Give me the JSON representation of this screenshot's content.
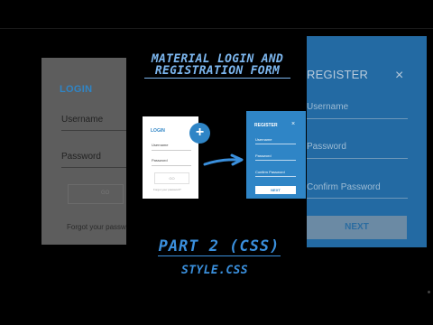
{
  "title": {
    "line1": "MATERIAL LOGIN AND",
    "line2": "REGISTRATION FORM"
  },
  "part": "PART 2 (CSS)",
  "file": "STYLE.CSS",
  "login_bg": {
    "title": "LOGIN",
    "username": "Username",
    "password": "Password",
    "go": "GO",
    "forgot": "Forgot your passw"
  },
  "register_bg": {
    "title": "REGISTER",
    "close": "×",
    "username": "Username",
    "password": "Password",
    "confirm": "Confirm Password",
    "next": "NEXT"
  },
  "login_card": {
    "title": "LOGIN",
    "username": "Username",
    "password": "Password",
    "go": "GO",
    "forgot": "Forgot your password?"
  },
  "plus": "+",
  "register_card": {
    "title": "REGISTER",
    "close": "×",
    "username": "Username",
    "password": "Password",
    "confirm": "Confirm Password",
    "next": "NEXT"
  },
  "colors": {
    "accent": "#2f85c6",
    "title": "#7cb6ee",
    "background": "#000000"
  },
  "icons": {
    "plus": "plus-icon",
    "arrow": "arrow-right-icon",
    "close": "close-icon"
  }
}
